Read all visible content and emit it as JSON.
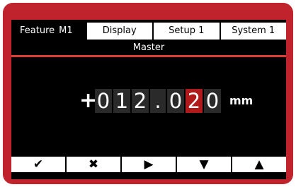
{
  "tabs": [
    {
      "label": "Feature",
      "suffix": "M1",
      "active": true
    },
    {
      "label": "Display"
    },
    {
      "label": "Setup 1"
    },
    {
      "label": "System 1"
    }
  ],
  "mode_label": "Master",
  "readout": {
    "sign": "+",
    "digits": [
      "0",
      "1",
      "2",
      ".",
      "0",
      "2",
      "0"
    ],
    "selected_digit_index": 5,
    "unit": "mm"
  },
  "softkeys": [
    {
      "label": "✔",
      "icon": "check-icon"
    },
    {
      "label": "✖",
      "icon": "cancel-icon"
    },
    {
      "label": "▶",
      "icon": "right-arrow-icon"
    },
    {
      "label": "▼",
      "icon": "down-arrow-icon"
    },
    {
      "label": "▲",
      "icon": "up-arrow-icon"
    }
  ],
  "colors": {
    "bezel": "#c0232c",
    "accent_line": "#e03a36",
    "selected_digit": "#b01a1a"
  }
}
